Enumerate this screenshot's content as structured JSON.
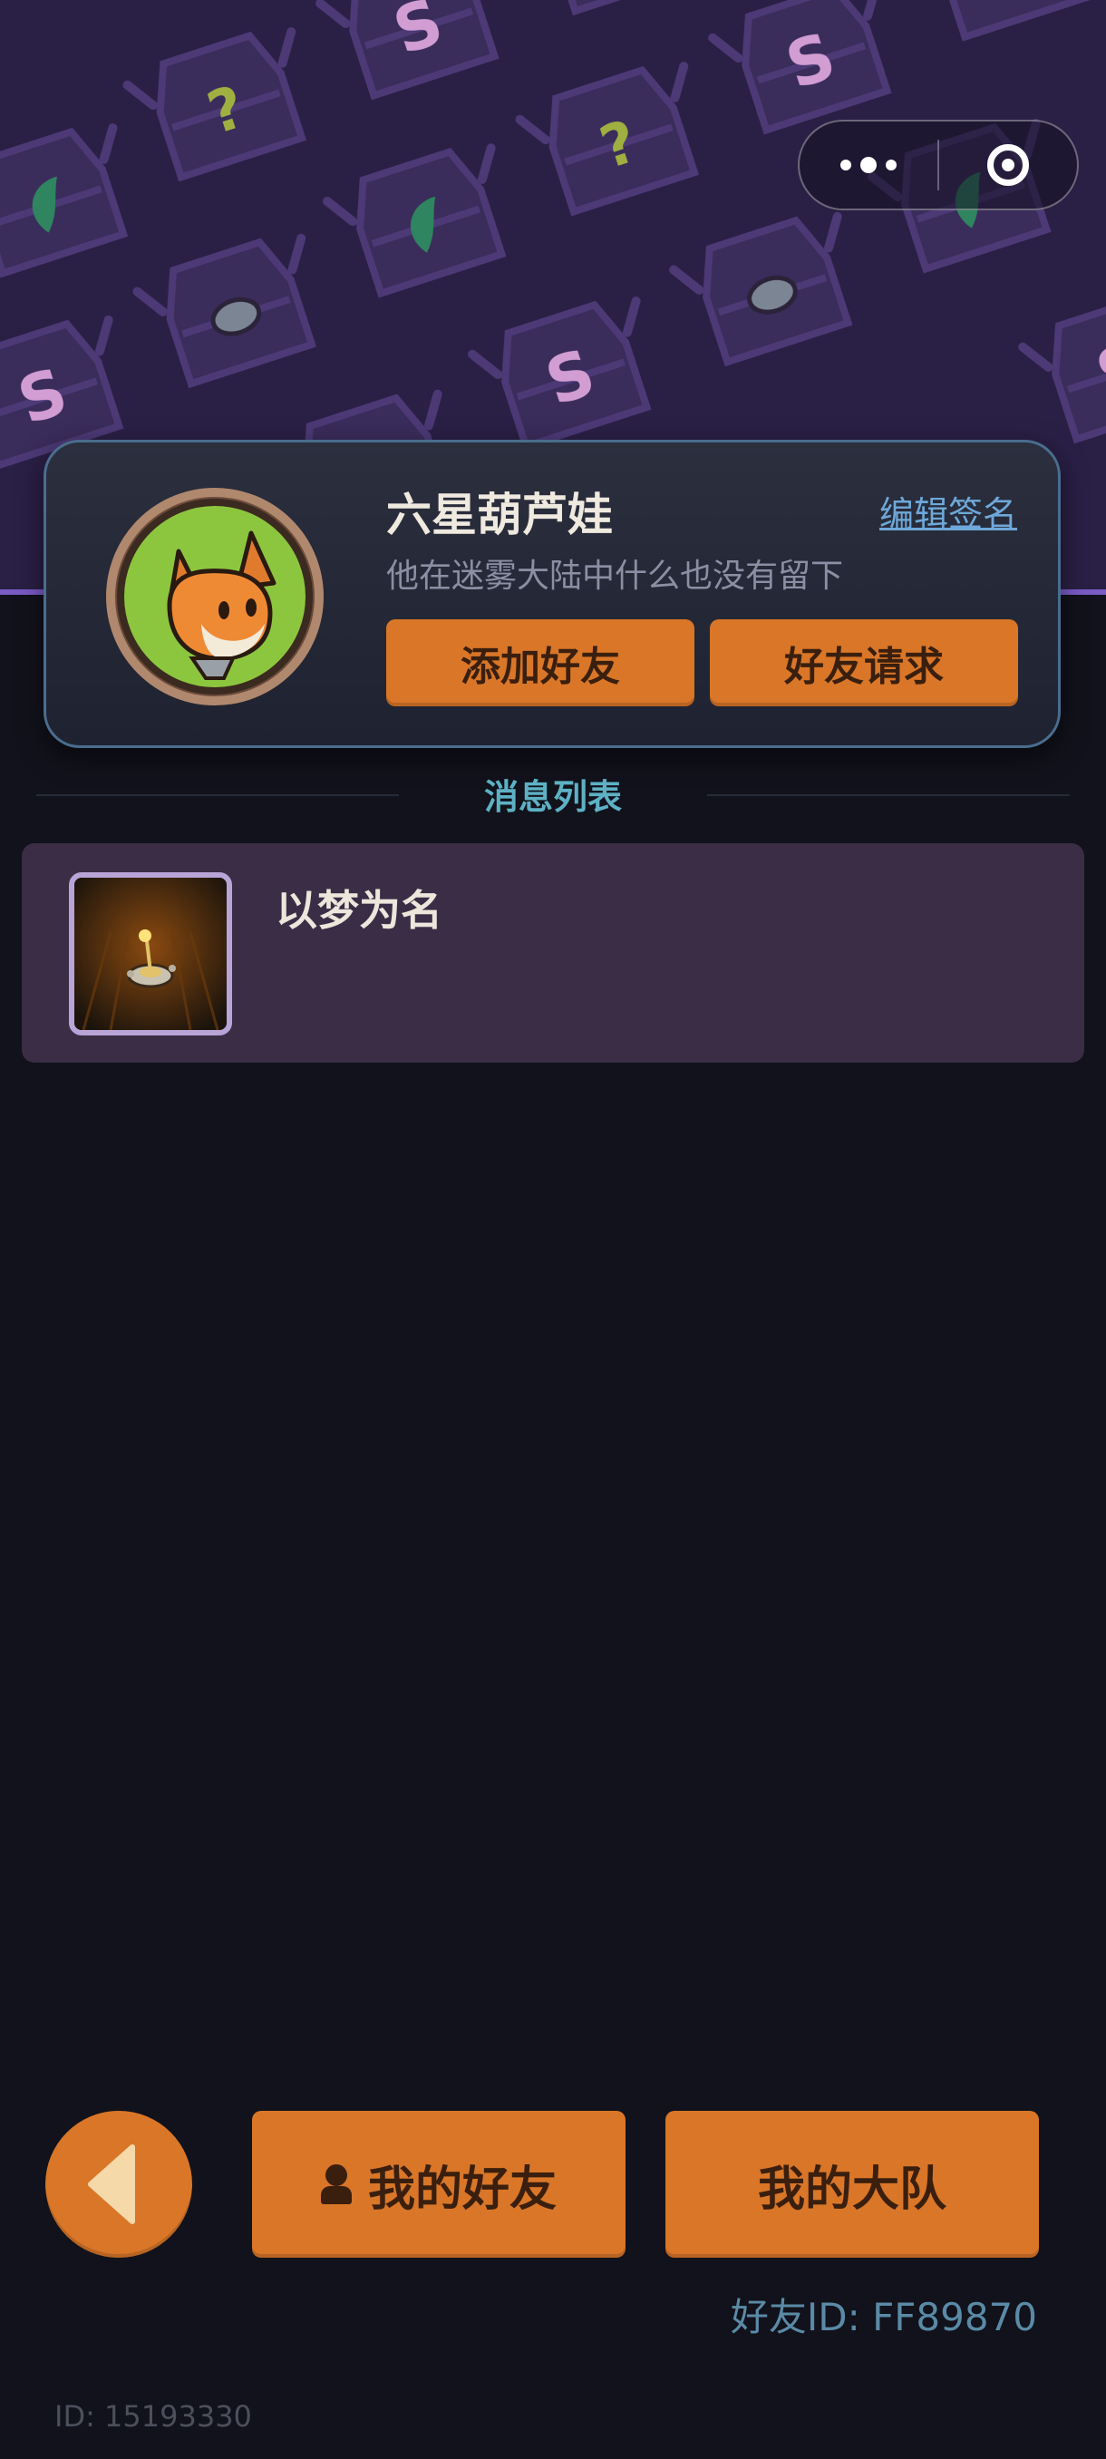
{
  "capsule": {
    "more_icon": "more-dots-icon",
    "close_icon": "target-ring-icon"
  },
  "profile": {
    "nickname": "六星葫芦娃",
    "edit_signature_label": "编辑签名",
    "signature": "他在迷雾大陆中什么也没有留下",
    "add_friend_label": "添加好友",
    "friend_request_label": "好友请求",
    "avatar_icon": "fox-avatar-icon"
  },
  "messages": {
    "section_title": "消息列表",
    "items": [
      {
        "title": "以梦为名",
        "thumb_icon": "joystick-trophy-icon"
      }
    ]
  },
  "bottom": {
    "back_icon": "back-triangle-icon",
    "my_friends_label": "我的好友",
    "my_team_label": "我的大队",
    "friend_id_text": "好友ID: FF89870",
    "user_id_text": "ID: 15193330"
  },
  "colors": {
    "background": "#11121b",
    "header": "#2a1f45",
    "accent_orange": "#d97628",
    "card_border": "#4a6d8e",
    "section_title": "#5eb1c4",
    "list_item": "#3a2d45"
  }
}
